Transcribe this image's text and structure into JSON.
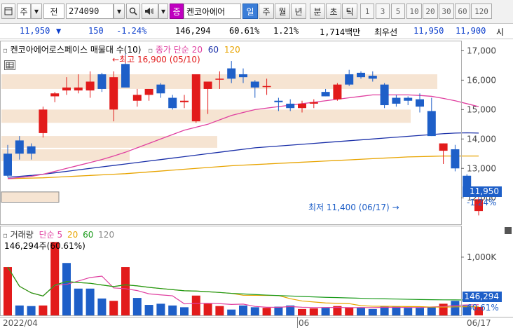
{
  "toolbar": {
    "market_type": "주",
    "market_type2": "전",
    "code": "274090",
    "security_badge": "증",
    "stock_name": "켄코아에어",
    "periods": [
      "일",
      "주",
      "월",
      "년",
      "분",
      "초",
      "틱"
    ],
    "active_period": "일",
    "intervals": [
      "1",
      "3",
      "5",
      "10",
      "20",
      "30",
      "60",
      "120"
    ]
  },
  "quote": {
    "price": "11,950",
    "change": "150",
    "change_pct": "-1.24%",
    "volume": "146,294",
    "volume_ratio": "60.61%",
    "turnover_ratio": "1.21%",
    "trade_amount": "1,714백만",
    "best_ask_label": "최우선",
    "best_ask": "11,950",
    "best_bid": "11,900",
    "trailing": "시"
  },
  "price_panel": {
    "title": "켄코아에어로스페이스 매물대 수(10)",
    "ma_label": "종가 단순",
    "ma_periods": [
      "20",
      "60",
      "120"
    ],
    "high_annotation": "최고 16,900 (05/10)",
    "low_annotation": "최저 11,400 (06/17)",
    "y_ticks": [
      "17,000",
      "16,000",
      "15,000",
      "14,000",
      "13,000",
      "12,000"
    ],
    "current_price_tag": "11,950",
    "current_change_tag": "-1.24%"
  },
  "volume_panel": {
    "title": "거래량",
    "ma_label": "단순",
    "ma_periods": [
      "5",
      "20",
      "60",
      "120"
    ],
    "readout": "146,294주(60.61%)",
    "y_tick": "1,000K",
    "current_volume_tag": "146,294",
    "current_ratio_tag": "60.61%"
  },
  "x_axis": {
    "start_label": "2022/04",
    "month_label": "06",
    "end_label": "06/17"
  },
  "colors": {
    "up": "#e21b1b",
    "down": "#1e5fc8",
    "ma20": "#e040a0",
    "ma60": "#1a2fa8",
    "ma120": "#e8a400",
    "volume_profile": "#f6e4d2",
    "badge_magenta": "#c000c0",
    "badge_blue": "#3a7dd8"
  },
  "chart_data": {
    "type": "candlestick",
    "ohlc": [
      [
        13500,
        13800,
        12700,
        12750
      ],
      [
        13950,
        14100,
        13300,
        13500
      ],
      [
        13750,
        13850,
        13300,
        13500
      ],
      [
        14200,
        15100,
        14050,
        15000
      ],
      [
        15450,
        15600,
        15250,
        15550
      ],
      [
        15650,
        16100,
        15500,
        15750
      ],
      [
        15650,
        16200,
        15550,
        15750
      ],
      [
        15650,
        16300,
        15400,
        15950
      ],
      [
        16200,
        16250,
        15600,
        15700
      ],
      [
        15000,
        16300,
        14600,
        16100
      ],
      [
        16550,
        16900,
        15850,
        15750
      ],
      [
        15300,
        15700,
        15100,
        15500
      ],
      [
        15500,
        15700,
        15300,
        15700
      ],
      [
        15850,
        15900,
        15400,
        15550
      ],
      [
        15400,
        15500,
        15000,
        15050
      ],
      [
        15250,
        15500,
        15050,
        15300
      ],
      [
        14600,
        14700,
        14550,
        16200
      ],
      [
        15700,
        15800,
        14850,
        15950
      ],
      [
        16050,
        16300,
        15700,
        16050
      ],
      [
        16400,
        16650,
        15900,
        16050
      ],
      [
        16200,
        16400,
        15900,
        16100
      ],
      [
        15950,
        16000,
        15400,
        15750
      ],
      [
        15800,
        16050,
        15500,
        15800
      ],
      [
        15300,
        15400,
        14950,
        15250
      ],
      [
        15200,
        15350,
        14950,
        15050
      ],
      [
        15050,
        15300,
        14900,
        15200
      ],
      [
        15200,
        15350,
        15050,
        15250
      ],
      [
        15600,
        15700,
        15450,
        15450
      ],
      [
        15350,
        15900,
        15300,
        15850
      ],
      [
        16200,
        16350,
        15800,
        15850
      ],
      [
        16250,
        16300,
        16050,
        16100
      ],
      [
        16150,
        16300,
        15950,
        16050
      ],
      [
        15850,
        15900,
        15050,
        15150
      ],
      [
        15400,
        15500,
        15100,
        15200
      ],
      [
        15400,
        15450,
        15150,
        15300
      ],
      [
        15350,
        15550,
        14900,
        15100
      ],
      [
        14950,
        15400,
        14100,
        14100
      ],
      [
        13600,
        13850,
        13150,
        13850
      ],
      [
        13650,
        13800,
        12900,
        13000
      ],
      [
        12750,
        12800,
        12050,
        12150
      ],
      [
        11550,
        12050,
        11400,
        11950
      ]
    ],
    "ma20": [
      12650,
      12690,
      12730,
      12800,
      12900,
      13000,
      13100,
      13200,
      13300,
      13420,
      13550,
      13700,
      13850,
      14000,
      14150,
      14300,
      14400,
      14500,
      14650,
      14800,
      14900,
      15000,
      15050,
      15100,
      15150,
      15200,
      15250,
      15300,
      15350,
      15400,
      15450,
      15500,
      15500,
      15500,
      15500,
      15480,
      15450,
      15380,
      15300,
      15200,
      15100
    ],
    "ma60": [
      12700,
      12730,
      12760,
      12800,
      12850,
      12900,
      12950,
      13000,
      13050,
      13100,
      13150,
      13200,
      13250,
      13300,
      13350,
      13400,
      13450,
      13500,
      13550,
      13600,
      13650,
      13700,
      13730,
      13760,
      13790,
      13820,
      13850,
      13880,
      13910,
      13940,
      13970,
      14000,
      14030,
      14060,
      14090,
      14120,
      14150,
      14180,
      14200,
      14210,
      14200
    ],
    "ma120": [
      12650,
      12660,
      12670,
      12680,
      12700,
      12720,
      12740,
      12760,
      12780,
      12800,
      12820,
      12850,
      12880,
      12910,
      12940,
      12970,
      13000,
      13030,
      13060,
      13090,
      13110,
      13130,
      13150,
      13170,
      13190,
      13210,
      13230,
      13250,
      13270,
      13290,
      13310,
      13330,
      13350,
      13370,
      13390,
      13400,
      13410,
      13420,
      13420,
      13420,
      13420
    ],
    "volume": [
      830,
      170,
      160,
      170,
      1260,
      900,
      460,
      460,
      290,
      250,
      830,
      300,
      180,
      200,
      170,
      140,
      340,
      200,
      160,
      100,
      170,
      140,
      130,
      150,
      170,
      110,
      120,
      130,
      160,
      140,
      130,
      110,
      160,
      150,
      130,
      130,
      150,
      200,
      250,
      170,
      146
    ],
    "volume_up": [
      true,
      false,
      false,
      true,
      true,
      false,
      false,
      false,
      false,
      true,
      true,
      false,
      false,
      false,
      false,
      false,
      true,
      true,
      true,
      false,
      false,
      false,
      true,
      false,
      false,
      true,
      true,
      false,
      true,
      true,
      false,
      false,
      false,
      false,
      false,
      false,
      false,
      true,
      false,
      false,
      true
    ],
    "y_range": [
      11100,
      17200
    ],
    "volume_range": [
      0,
      1300
    ]
  }
}
